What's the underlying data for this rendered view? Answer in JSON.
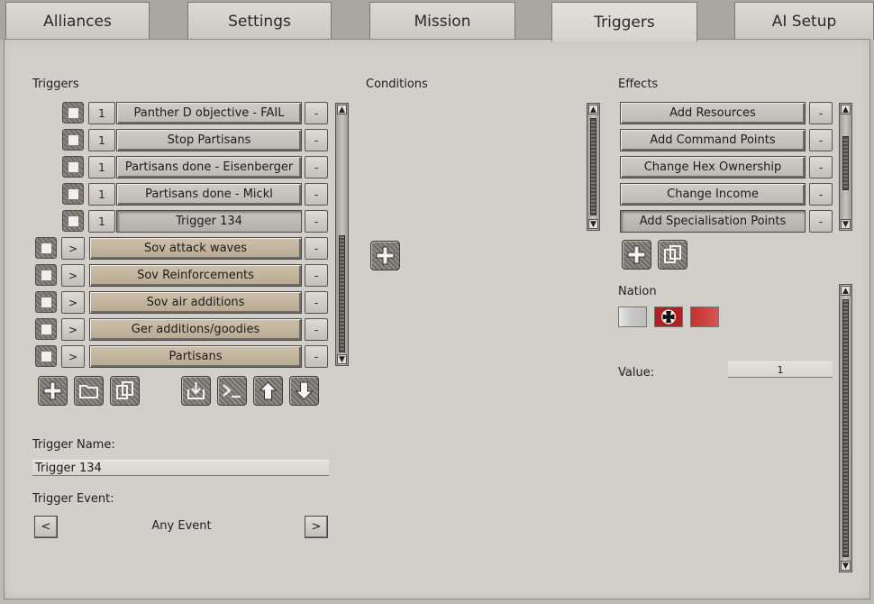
{
  "tabs": [
    "Alliances",
    "Settings",
    "Mission",
    "Triggers",
    "AI Setup"
  ],
  "active_tab": "Triggers",
  "triggers": {
    "heading": "Triggers",
    "rows": [
      {
        "ctrl": "1",
        "label": "Panther D  objective - FAIL",
        "remove": "-"
      },
      {
        "ctrl": "1",
        "label": "Stop Partisans",
        "remove": "-"
      },
      {
        "ctrl": "1",
        "label": "Partisans done - Eisenberger",
        "remove": "-"
      },
      {
        "ctrl": "1",
        "label": "Partisans done - Mickl",
        "remove": "-"
      },
      {
        "ctrl": "1",
        "label": "Trigger 134",
        "remove": "-"
      },
      {
        "ctrl": ">",
        "label": "Sov attack waves",
        "remove": "-"
      },
      {
        "ctrl": ">",
        "label": "Sov Reinforcements",
        "remove": "-"
      },
      {
        "ctrl": ">",
        "label": "Sov air additions",
        "remove": "-"
      },
      {
        "ctrl": ">",
        "label": "Ger additions/goodies",
        "remove": "-"
      },
      {
        "ctrl": ">",
        "label": "Partisans",
        "remove": "-"
      }
    ],
    "toolbar_icons": [
      "add-icon",
      "folder-icon",
      "copy-icon",
      "import-icon",
      "console-icon",
      "move-up-icon",
      "move-down-icon"
    ]
  },
  "trigger_name": {
    "label": "Trigger Name:",
    "value": "Trigger 134"
  },
  "trigger_event": {
    "label": "Trigger Event:",
    "prev": "<",
    "value": "Any Event",
    "next": ">"
  },
  "conditions": {
    "heading": "Conditions"
  },
  "effects": {
    "heading": "Effects",
    "rows": [
      {
        "label": "Add Resources",
        "remove": "-"
      },
      {
        "label": "Add Command Points",
        "remove": "-"
      },
      {
        "label": "Change Hex Ownership",
        "remove": "-"
      },
      {
        "label": "Change Income",
        "remove": "-"
      },
      {
        "label": "Add Specialisation Points",
        "remove": "-"
      }
    ]
  },
  "nation": {
    "label": "Nation",
    "flags": [
      "none",
      "germany",
      "soviet"
    ]
  },
  "value": {
    "label": "Value:",
    "value": "1"
  },
  "colors": {
    "tan_item": "#c4b69e",
    "grey_item": "#c6c3be",
    "panel": "#d2cfca"
  }
}
